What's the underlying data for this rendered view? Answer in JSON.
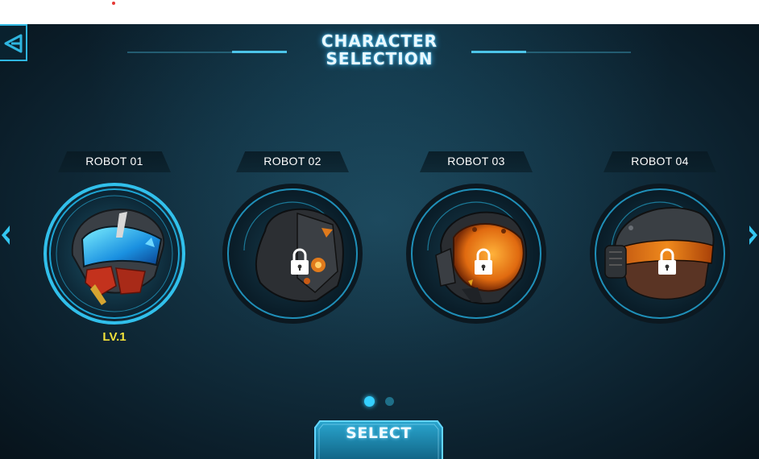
{
  "screen": {
    "title_line1": "CHARACTER",
    "title_line2": "SELECTION"
  },
  "robots": [
    {
      "name": "ROBOT 01",
      "level": "LV.1",
      "locked": false,
      "selected": true
    },
    {
      "name": "ROBOT 02",
      "locked": true,
      "selected": false
    },
    {
      "name": "ROBOT 03",
      "locked": true,
      "selected": false
    },
    {
      "name": "ROBOT 04",
      "locked": true,
      "selected": false
    }
  ],
  "pagination": {
    "current_page": 1,
    "total_pages": 2
  },
  "actions": {
    "select_label": "SELECT"
  },
  "icons": {
    "back": "back-arrow-icon",
    "prev": "chevron-left-icon",
    "next": "chevron-right-icon",
    "lock": "padlock-icon"
  },
  "colors": {
    "accent": "#2fb6e0",
    "glow": "#35d0ff",
    "level_text": "#f3e23a",
    "background": "#123040"
  }
}
